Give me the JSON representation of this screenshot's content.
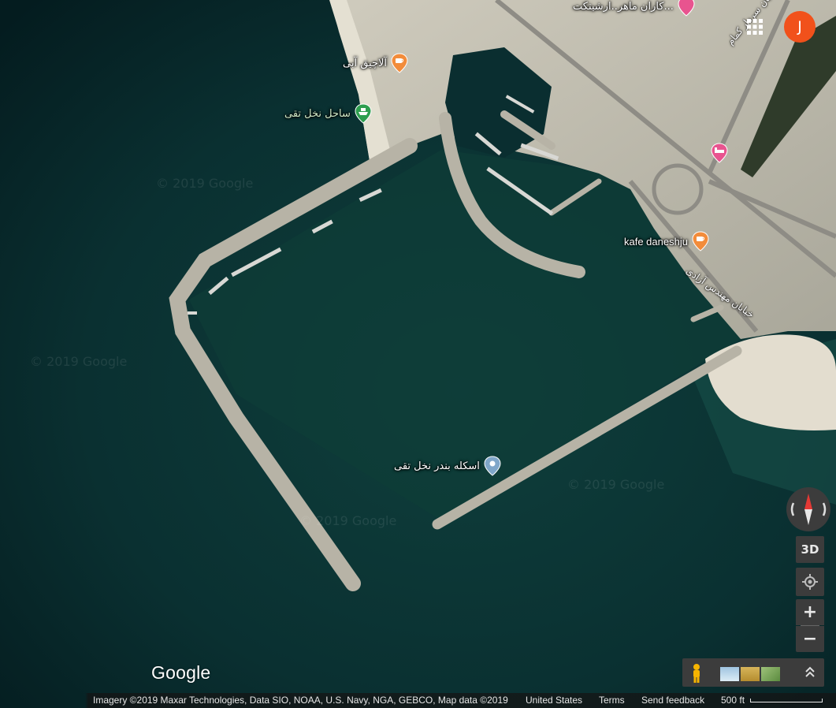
{
  "map": {
    "watermark": "© 2019 Google",
    "pois": [
      {
        "name": "poi-shop-top",
        "label": "کاران ماهر..ارشیتکت...",
        "icon": "shop-pin-icon",
        "type": "pink"
      },
      {
        "name": "poi-cafe-alachiq",
        "label": "آلاچیق آبی",
        "icon": "cafe-pin-icon",
        "type": "orange"
      },
      {
        "name": "poi-beach-sahel",
        "label": "ساحل نخل تقی",
        "icon": "ferry-pin-icon",
        "type": "green"
      },
      {
        "name": "poi-hotel",
        "label": "",
        "icon": "hotel-pin-icon",
        "type": "pink"
      },
      {
        "name": "poi-kafe-daneshju",
        "label": "kafe daneshju",
        "icon": "cafe-pin-icon",
        "type": "orange"
      },
      {
        "name": "poi-pier-eskele",
        "label": "اسکله بندر نخل تقی",
        "icon": "location-pin-icon",
        "type": "blue"
      }
    ],
    "road_labels": [
      {
        "name": "road-label-sardar",
        "text": "خیابان سردار کمام"
      },
      {
        "name": "road-label-azadi",
        "text": "خیابان مهندس آزادی"
      }
    ]
  },
  "account": {
    "initial": "J",
    "color": "#f1511b"
  },
  "controls": {
    "three_d_label": "3D",
    "zoom_in": "+",
    "zoom_out": "−"
  },
  "branding": {
    "logo": "Google"
  },
  "footer": {
    "attribution": "Imagery ©2019 Maxar Technologies, Data SIO, NOAA, U.S. Navy, NGA, GEBCO, Map data ©2019",
    "country": "United States",
    "terms": "Terms",
    "feedback": "Send feedback",
    "scale": "500 ft"
  },
  "colors": {
    "sea_deep": "#06282a",
    "sea": "#0d3b3b",
    "land": "#bdb9ac",
    "poi_orange": "#f28c3b",
    "poi_pink": "#e8548f",
    "poi_green": "#2e9e4f",
    "poi_blue": "#7fa6c9"
  }
}
